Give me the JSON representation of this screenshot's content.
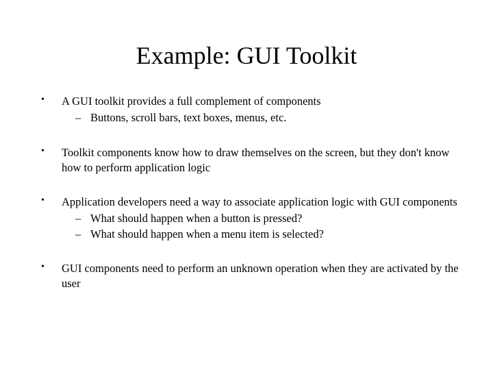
{
  "title": "Example: GUI Toolkit",
  "bullets": [
    {
      "text": "A GUI toolkit provides a full complement of components",
      "sub": [
        "Buttons, scroll bars, text boxes, menus, etc."
      ]
    },
    {
      "text": "Toolkit components know how to draw themselves on the screen, but they don't know how to perform application logic",
      "sub": []
    },
    {
      "text": "Application developers need a way to associate application logic with GUI components",
      "sub": [
        "What should happen when a button is pressed?",
        "What should happen when a menu item is selected?"
      ]
    },
    {
      "text": "GUI components need to perform an unknown operation when they are activated by the user",
      "sub": []
    }
  ]
}
